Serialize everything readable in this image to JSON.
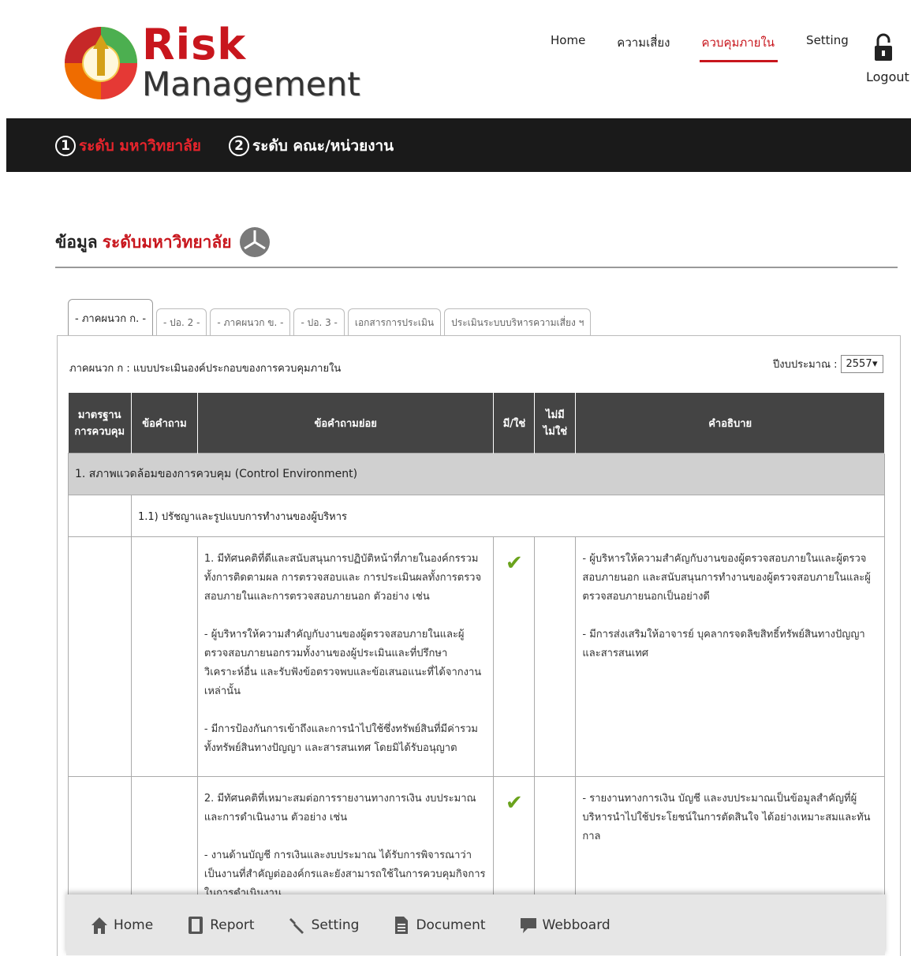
{
  "brand": {
    "line1": "Risk",
    "line2": "Management"
  },
  "topnav": [
    "Home",
    "ความเสี่ยง",
    "ควบคุมภายใน",
    "Setting"
  ],
  "logout": "Logout",
  "levels": [
    {
      "num": "1",
      "label": "ระดับ มหาวิทยาลัย"
    },
    {
      "num": "2",
      "label": "ระดับ คณะ/หน่วยงาน"
    }
  ],
  "section": {
    "prefix": "ข้อมูล",
    "highlight": "ระดับมหาวิทยาลัย"
  },
  "tabs": [
    "- ภาคผนวก ก. -",
    "- ปอ. 2 -",
    "- ภาคผนวก ข. -",
    "- ปอ. 3 -",
    "เอกสารการประเมิน",
    "ประเมินระบบบริหารความเสี่ยง ฯ"
  ],
  "panel_title": "ภาคผนวก ก : แบบประเมินองค์ประกอบของการควบคุมภายใน",
  "year": {
    "label": "ปีงบประมาณ :",
    "value": "2557"
  },
  "table": {
    "headers": {
      "c1": "มาตรฐาน การควบคุม",
      "c2": "ข้อคำถาม",
      "c3": "ข้อคำถามย่อย",
      "c4": "มี/ใช่",
      "c5": "ไม่มี ไม่ใช่",
      "c6": "คำอธิบาย"
    },
    "group": "1. สภาพแวดล้อมของการควบคุม (Control Environment)",
    "subgroup": "1.1) ปรัชญาและรูปแบบการทำงานของผู้บริหาร",
    "rows": [
      {
        "q1": "1. มีทัศนคติที่ดีและสนับสนุนการปฏิบัติหน้าที่ภายในองค์กรรวมทั้งการติดตามผล การตรวจสอบและ การประเมินผลทั้งการตรวจสอบภายในและการตรวจสอบภายนอก ตัวอย่าง เช่น",
        "q2": "- ผู้บริหารให้ความสำคัญกับงานของผู้ตรวจสอบภายในและผู้ตรวจสอบภายนอกรวมทั้งงานของผู้ประเมินและที่ปรึกษาวิเคราะห์อื่น และรับฟังข้อตรวจพบและข้อเสนอแนะที่ได้จากงานเหล่านั้น",
        "q3": "- มีการป้องกันการเข้าถึงและการนำไปใช้ซึ่งทรัพย์สินที่มีค่ารวมทั้งทรัพย์สินทางปัญญา และสารสนเทศ โดยมิได้รับอนุญาต",
        "check": "✔",
        "d1": "- ผู้บริหารให้ความสำคัญกับงานของผู้ตรวจสอบภายในและผู้ตรวจสอบภายนอก และสนับสนุนการทำงานของผู้ตรวจสอบภายในและผู้ตรวจสอบภายนอกเป็นอย่างดี",
        "d2": "- มีการส่งเสริมให้อาจารย์ บุคลากรจดลิขสิทธิ์ทรัพย์สินทางปัญญา และสารสนเทศ"
      },
      {
        "q1": "2. มีทัศนคติที่เหมาะสมต่อการรายงานทางการเงิน งบประมาณและการดำเนินงาน ตัวอย่าง เช่น",
        "q2": "- งานด้านบัญชี การเงินและงบประมาณ ได้รับการพิจารณาว่าเป็นงานที่สำคัญต่อองค์กรและยังสามารถใช้ในการควบคุมกิจการในการดำเนินงาน",
        "check": "✔",
        "d1": "- รายงานทางการเงิน บัญชี และงบประมาณเป็นข้อมูลสำคัญที่ผู้บริหารนำไปใช้ประโยชน์ในการตัดสินใจ ได้อย่างเหมาะสมและทันกาล"
      }
    ]
  },
  "bottomnav": [
    "Home",
    "Report",
    "Setting",
    "Document",
    "Webboard"
  ]
}
